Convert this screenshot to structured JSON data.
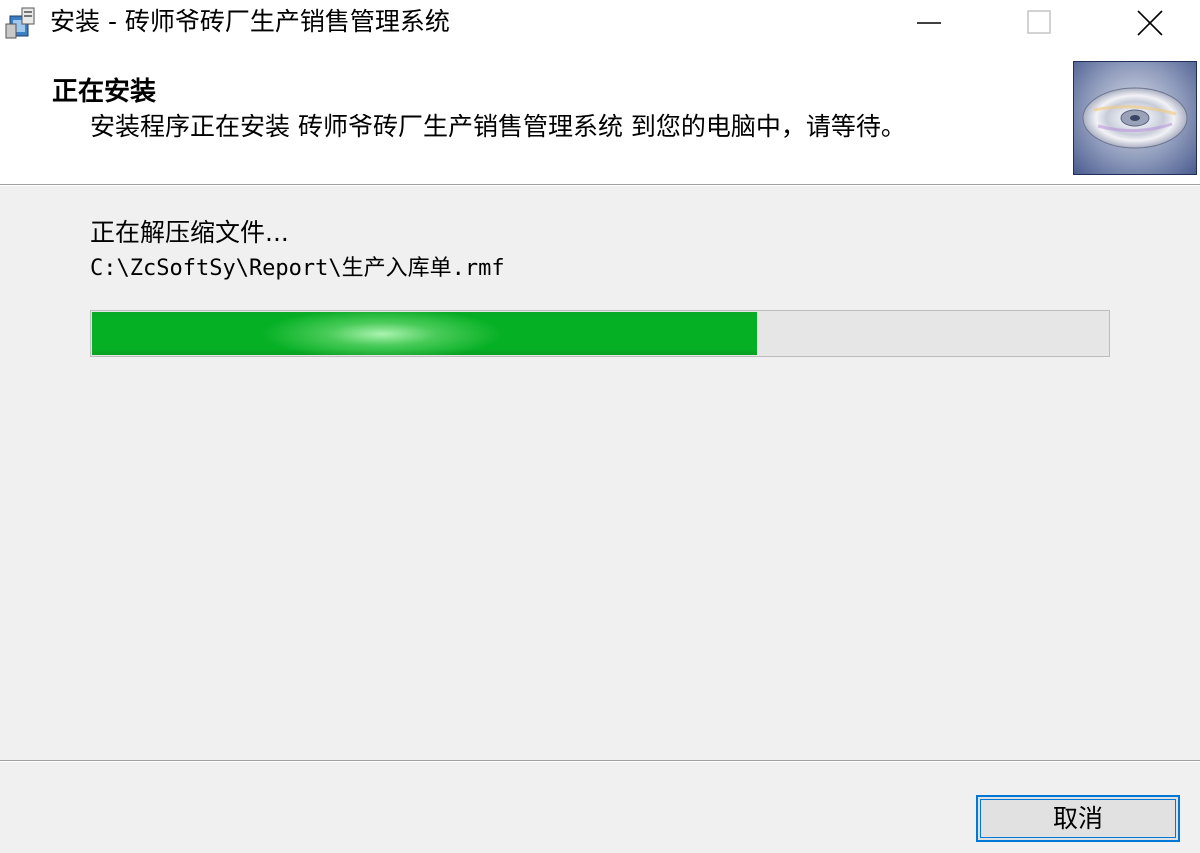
{
  "window": {
    "title": "安装 - 砖师爷砖厂生产销售管理系统",
    "icon": "installer-icon"
  },
  "controls": {
    "minimize_icon": "minimize-icon",
    "maximize_icon": "maximize-icon",
    "close_icon": "close-icon"
  },
  "header": {
    "title": "正在安装",
    "description": "安装程序正在安装 砖师爷砖厂生产销售管理系统 到您的电脑中，请等待。",
    "image": "cd-disc-icon"
  },
  "body": {
    "status": "正在解压缩文件...",
    "current_file": "C:\\ZcSoftSy\\Report\\生产入库单.rmf",
    "progress_fraction": 0.655
  },
  "footer": {
    "cancel_label": "取消"
  },
  "colors": {
    "progress_green": "#06b025",
    "focus_blue": "#0078d7"
  }
}
